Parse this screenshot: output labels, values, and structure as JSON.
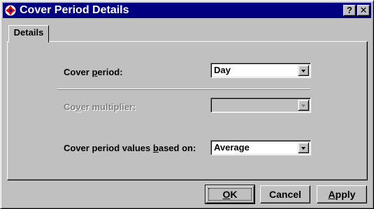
{
  "window": {
    "title": "Cover Period Details",
    "help_label": "?",
    "close_label": "✕",
    "icon": "app-icon"
  },
  "tabs": [
    {
      "label": "Details",
      "active": true
    }
  ],
  "fields": {
    "cover_period": {
      "label_before": "Cover ",
      "label_mnemonic": "p",
      "label_after": "eriod:",
      "value": "Day",
      "enabled": true
    },
    "cover_multiplier": {
      "label_before": "Co",
      "label_mnemonic": "v",
      "label_after": "er multiplier:",
      "value": "",
      "enabled": false
    },
    "cover_period_values_based_on": {
      "label_before": "Cover period values ",
      "label_mnemonic": "b",
      "label_after": "ased on:",
      "value": "Average",
      "enabled": true
    }
  },
  "buttons": {
    "ok": {
      "mnemonic": "O",
      "rest": "K"
    },
    "cancel": {
      "label": "Cancel"
    },
    "apply": {
      "mnemonic": "A",
      "rest": "pply"
    }
  },
  "colors": {
    "titlebar": "#000080",
    "face": "#c0c0c0",
    "disabled_text": "#808080"
  }
}
